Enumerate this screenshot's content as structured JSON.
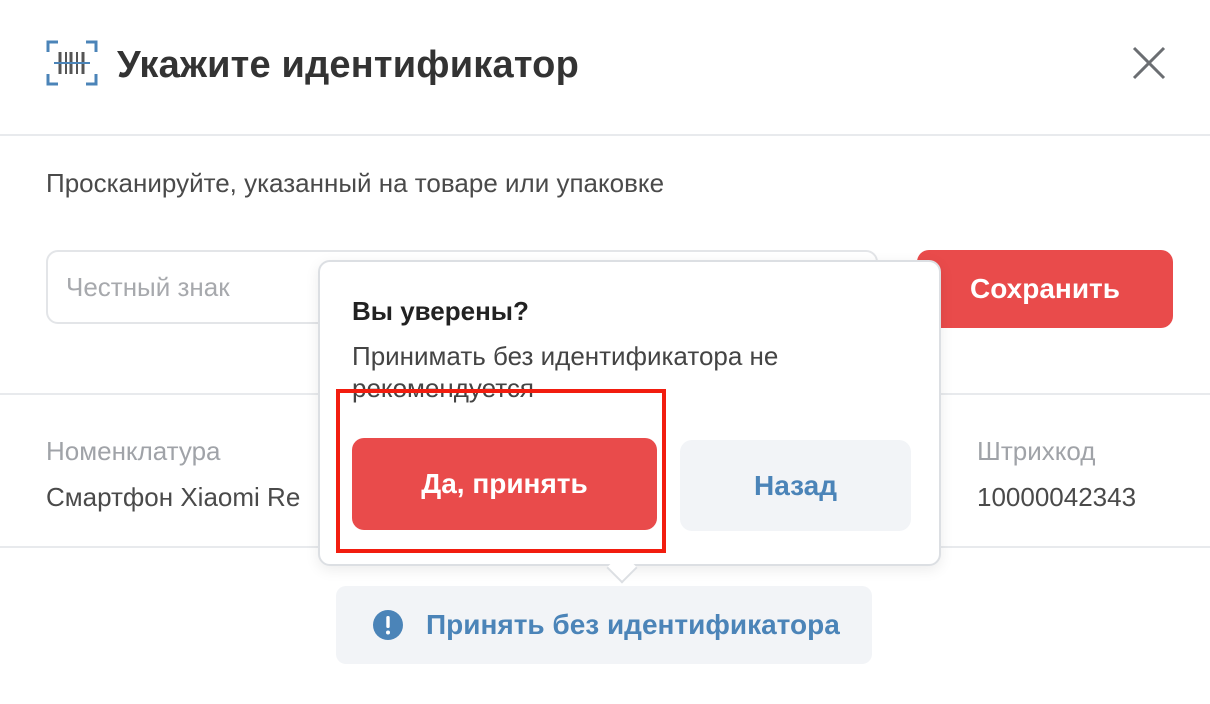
{
  "dialog": {
    "title": "Укажите идентификатор",
    "header_icon": "barcode-scan-icon",
    "close_icon": "close-icon"
  },
  "form": {
    "instruction": "Просканируйте, указанный на товаре или упаковке",
    "input_placeholder": "Честный знак",
    "input_value": "",
    "save_label": "Сохранить"
  },
  "product": {
    "nomenclature_label": "Номенклатура",
    "nomenclature_value": "Смартфон Xiaomi Re",
    "barcode_label": "Штрихкод",
    "barcode_value": "10000042343"
  },
  "accept_without": {
    "icon": "info-icon",
    "label": "Принять без идентификатора"
  },
  "popover": {
    "title": "Вы уверены?",
    "text": "Принимать без идентификатора не рекомендуется",
    "confirm_label": "Да, принять",
    "back_label": "Назад"
  },
  "colors": {
    "accent_red": "#e94b4b",
    "link_blue": "#4b84b8",
    "highlight": "#f21d0f"
  }
}
